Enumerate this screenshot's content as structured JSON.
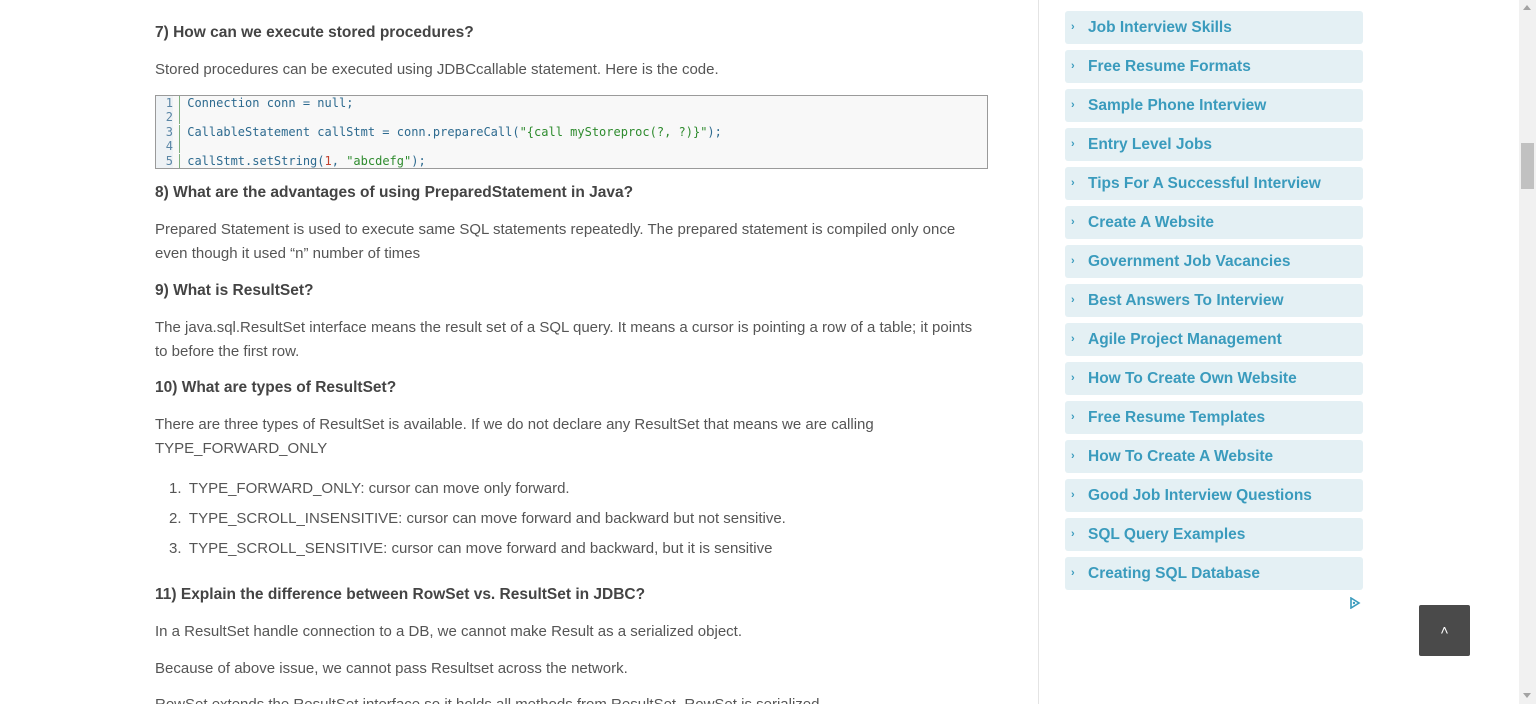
{
  "article": {
    "q7": "7) How can we execute stored procedures?",
    "p7": "Stored procedures can be executed using JDBCcallable statement. Here is the code.",
    "code": {
      "line_numbers": [
        "1",
        "2",
        "3",
        "4",
        "5"
      ],
      "line1_a": "Connection conn = ",
      "line1_b": "null",
      "line1_c": ";",
      "line3_a": "CallableStatement callStmt = conn.prepareCall(",
      "line3_b": "\"{call myStoreproc(?, ?)}\"",
      "line3_c": ");",
      "line5_a": "callStmt.setString(",
      "line5_b": "1",
      "line5_c": ", ",
      "line5_d": "\"abcdefg\"",
      "line5_e": ");"
    },
    "q8": "8) What are the advantages of using PreparedStatement in Java?",
    "p8": "Prepared Statement is used to execute same SQL statements repeatedly. The prepared statement is compiled only once even though it used “n” number of times",
    "q9": "9) What is ResultSet?",
    "p9": "The java.sql.ResultSet interface means the result set of a SQL query. It means a cursor is pointing a row of a table; it points to before the first row.",
    "q10": "10) What are types of ResultSet?",
    "p10": "There are three types of ResultSet is available. If we do not declare any ResultSet that means we are calling TYPE_FORWARD_ONLY",
    "list": [
      {
        "n": "1.",
        "text": "TYPE_FORWARD_ONLY: cursor can move only forward."
      },
      {
        "n": "2.",
        "text": "TYPE_SCROLL_INSENSITIVE: cursor can move forward and backward but not sensitive."
      },
      {
        "n": "3.",
        "text": "TYPE_SCROLL_SENSITIVE: cursor can move forward and backward, but it is sensitive"
      }
    ],
    "q11": "11) Explain the difference between RowSet vs. ResultSet in JDBC?",
    "p11a": "In a ResultSet handle connection to a DB, we cannot make Result as a serialized object.",
    "p11b": "Because of above issue, we cannot pass  Resultset across the network.",
    "p11c": "RowSet extends the ResultSet interface so it holds all methods from ResultSet. RowSet is serialized."
  },
  "sidebar": {
    "items": [
      {
        "label": "Job Interview Skills"
      },
      {
        "label": "Free Resume Formats"
      },
      {
        "label": "Sample Phone Interview"
      },
      {
        "label": "Entry Level Jobs"
      },
      {
        "label": "Tips For A Successful Interview"
      },
      {
        "label": "Create A Website"
      },
      {
        "label": "Government Job Vacancies"
      },
      {
        "label": "Best Answers To Interview"
      },
      {
        "label": "Agile Project Management"
      },
      {
        "label": "How To Create Own Website"
      },
      {
        "label": "Free Resume Templates"
      },
      {
        "label": "How To Create A Website"
      },
      {
        "label": "Good Job Interview Questions"
      },
      {
        "label": "SQL Query Examples"
      },
      {
        "label": "Creating SQL Database"
      }
    ],
    "chevron": "›",
    "accent": "#3a9bbd"
  },
  "controls": {
    "back_to_top": "˄"
  }
}
